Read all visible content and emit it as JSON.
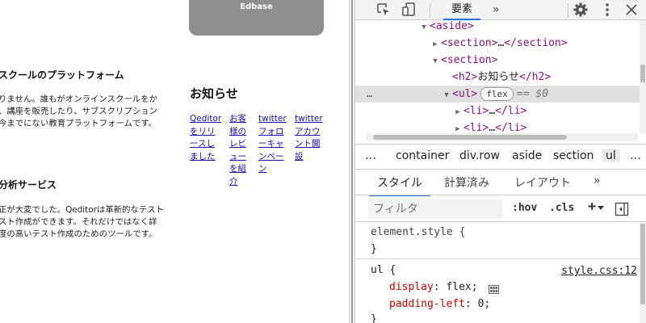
{
  "page": {
    "edbase_label": "Edbase",
    "services": [
      {
        "title": "スクールのプラットフォーム",
        "lines": [
          "りません。誰もがオンラインスクールをか",
          "、講座を販売したり、サブスクリプション",
          "今までにない教育プラットフォームです。"
        ]
      },
      {
        "title": "分析サービス",
        "lines": [
          "正が大変でした。Qeditorは革新的なテスト",
          "スト作成ができます。それだけではなく詳",
          "度の高いテスト作成のためのツールです。"
        ]
      }
    ],
    "news": {
      "title": "お知らせ",
      "links": [
        {
          "lines": [
            "Qeditor",
            "をリリ",
            "ースし",
            "ました"
          ]
        },
        {
          "lines": [
            "お客",
            "様の",
            "レビ",
            "ュー",
            "を紹",
            "介"
          ]
        },
        {
          "lines": [
            "twitter",
            "フォロ",
            "ーキャ",
            "ンペー",
            "ン"
          ]
        },
        {
          "lines": [
            "twitter",
            "アカウ",
            "ント開",
            "設"
          ]
        }
      ]
    }
  },
  "devtools": {
    "tabs": {
      "elements": "要素",
      "more": "»"
    },
    "icons": [
      "inspect-icon",
      "device-toolbar-icon",
      "settings-gear-icon",
      "close-icon",
      "more-vert-icon"
    ],
    "dom": {
      "aside": "<aside>",
      "section_collapsed_open": "<section>",
      "section_collapsed_ellipsis": "…",
      "section_collapsed_close": "</section>",
      "section_open": "<section>",
      "h2_open": "<h2>",
      "h2_text": "お知らせ",
      "h2_close": "</h2>",
      "ul_open": "<ul>",
      "flex_badge": "flex",
      "eq_text": "== $0",
      "li_open": "<li>",
      "li_ellipsis": "…",
      "li_close": "</li>",
      "row_dots": "…"
    },
    "breadcrumbs": [
      "…",
      "container",
      "div.row",
      "aside",
      "section",
      "ul",
      "…"
    ],
    "style_tabs": [
      "スタイル",
      "計算済み",
      "レイアウト",
      "»"
    ],
    "filter": {
      "placeholder": "フィルタ",
      "hov": ":hov",
      "cls": ".cls",
      "plus": "+"
    },
    "rules": {
      "element_style": {
        "selector": "element.style {",
        "close": "}"
      },
      "ul": {
        "selector": "ul {",
        "source": "style.css:12",
        "props": [
          {
            "name": "display",
            "value": "flex;"
          },
          {
            "name": "padding-left",
            "value": "0;"
          }
        ],
        "close": "}"
      }
    },
    "colors": {
      "accent": "#1a73e8",
      "tag": "#881280",
      "prop": "#c80000",
      "selected_row": "#e0e0e0"
    }
  }
}
